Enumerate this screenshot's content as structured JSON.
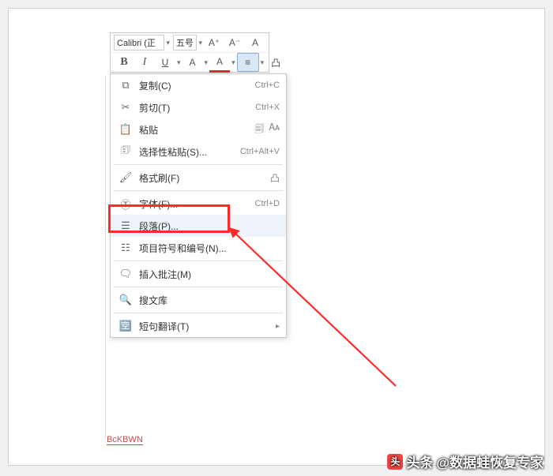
{
  "toolbar": {
    "font_name": "Calibri (正",
    "font_size": "五号",
    "inc": "A⁺",
    "dec": "A⁻",
    "clear": "A",
    "bold": "B",
    "italic": "I",
    "under": "U",
    "strike": "A",
    "color": "A",
    "align": "≡",
    "hl": "凸"
  },
  "menu": {
    "copy": {
      "label": "复制(C)",
      "shortcut": "Ctrl+C"
    },
    "cut": {
      "label": "剪切(T)",
      "shortcut": "Ctrl+X"
    },
    "paste": {
      "label": "粘贴"
    },
    "paste_special": {
      "label": "选择性粘贴(S)...",
      "shortcut": "Ctrl+Alt+V"
    },
    "format_painter": {
      "label": "格式刷(F)"
    },
    "font": {
      "label": "字体(F)...",
      "shortcut": "Ctrl+D"
    },
    "paragraph": {
      "label": "段落(P)..."
    },
    "bullets": {
      "label": "项目符号和编号(N)..."
    },
    "insert_comment": {
      "label": "插入批注(M)"
    },
    "souwen": {
      "label": "搜文库"
    },
    "translate": {
      "label": "短句翻译(T)"
    }
  },
  "doc": {
    "sample_text": "BcKBWN"
  },
  "attribution": {
    "prefix": "头条",
    "author": "@数据蛙恢复专家"
  }
}
